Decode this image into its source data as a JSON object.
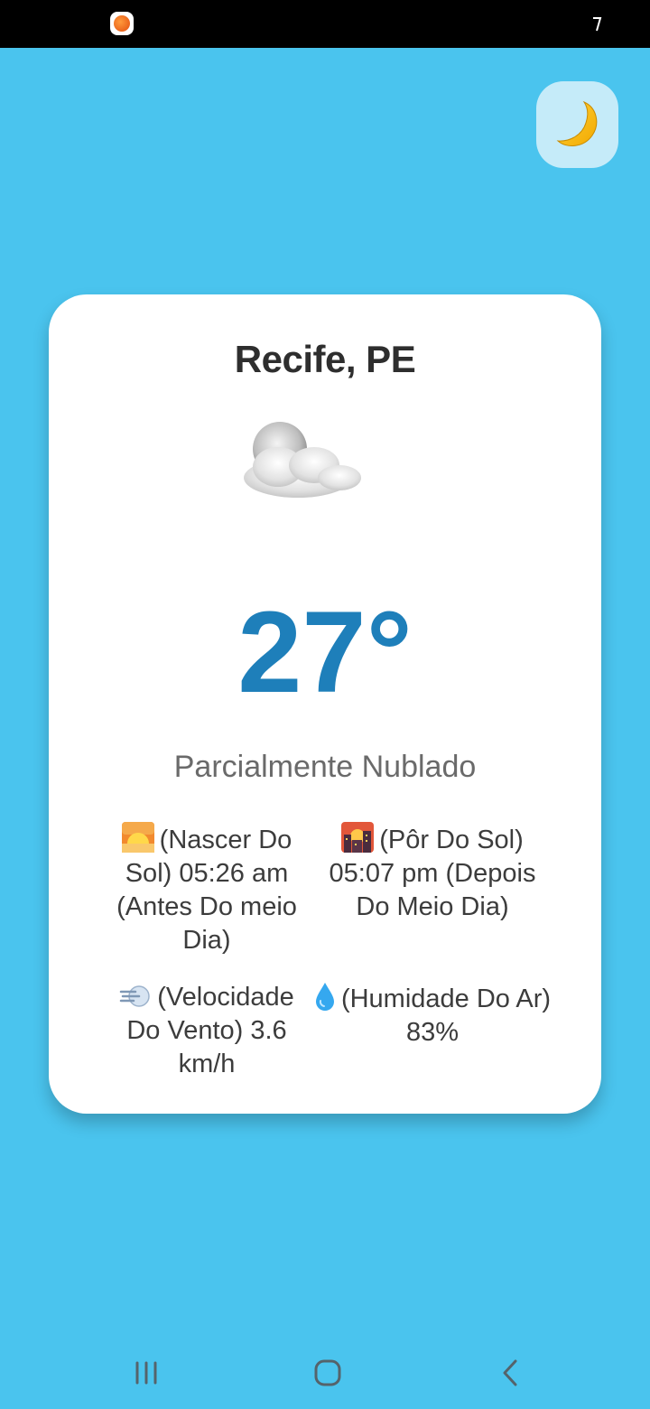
{
  "status_bar": {
    "app_icon": "orange-app-icon",
    "right_icon": "bolt-icon"
  },
  "theme_toggle": {
    "icon": "crescent-moon-icon"
  },
  "weather": {
    "city": "Recife, PE",
    "condition_icon": "partly-cloudy-icon",
    "temperature": "27°",
    "condition": "Parcialmente Nublado",
    "details": [
      {
        "icon": "sunrise-icon",
        "text": "(Nascer Do Sol) 05:26 am (Antes Do meio Dia)"
      },
      {
        "icon": "sunset-city-icon",
        "text": "(Pôr Do Sol) 05:07 pm (Depois Do Meio Dia)"
      },
      {
        "icon": "wind-icon",
        "text": "(Velocidade Do Vento) 3.6 km/h"
      },
      {
        "icon": "droplet-icon",
        "text": "(Humidade Do Ar) 83%"
      }
    ]
  },
  "nav_bar": {
    "recents_icon": "recent-apps-icon",
    "home_icon": "home-icon",
    "back_icon": "back-icon"
  },
  "colors": {
    "background": "#4ac4ee",
    "card": "#ffffff",
    "temperature": "#1e7fba",
    "toggle": "#c5ebf9"
  }
}
